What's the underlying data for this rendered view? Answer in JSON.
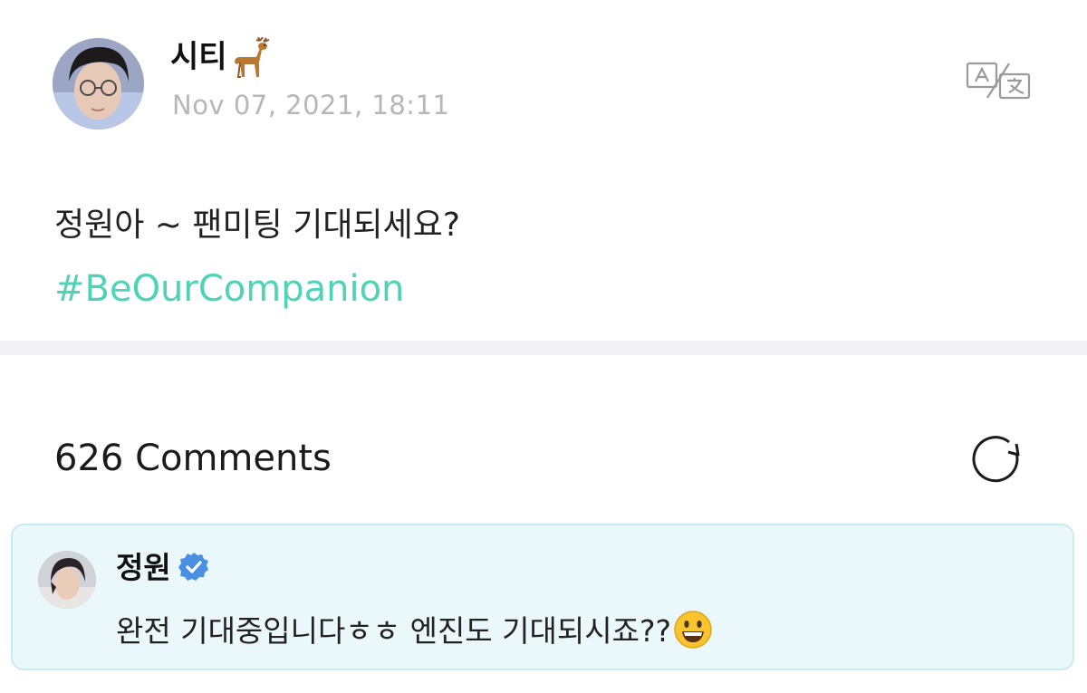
{
  "post": {
    "author_name": "시티",
    "author_emoji_icon": "deer-icon",
    "date": "Nov 07, 2021, 18:11",
    "body": "정원아 ~ 팬미팅 기대되세요?",
    "hashtag": "#BeOurCompanion",
    "hashtag_color": "#4fd3b6",
    "translate_icon": "translate-icon"
  },
  "comments": {
    "count_label": "626 Comments",
    "refresh_icon": "refresh-icon",
    "highlighted": {
      "author": "정원",
      "verified_icon": "verified-badge-icon",
      "verified_color": "#4a90e2",
      "text": "완전 기대중입니다ㅎㅎ 엔진도 기대되시죠??",
      "trailing_emoji_icon": "grinning-face-icon",
      "card_background": "#eaf7fb",
      "card_border": "#c9ebf2"
    }
  }
}
